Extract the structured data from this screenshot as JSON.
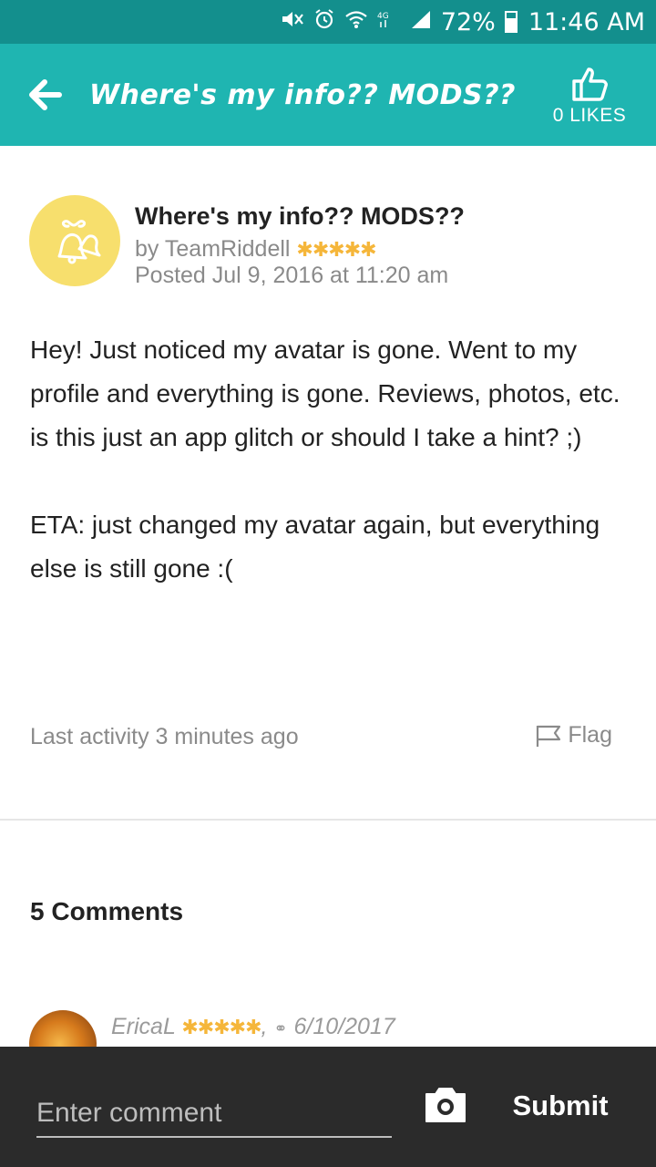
{
  "status_bar": {
    "battery_percent": "72%",
    "time": "11:46 AM",
    "icons": [
      "mute-icon",
      "alarm-icon",
      "wifi-icon",
      "lte-icon",
      "signal-icon",
      "battery-icon"
    ]
  },
  "app_bar": {
    "title": "Where's my info?? MODS??",
    "likes_label": "0 LIKES",
    "icons": [
      "back-arrow-icon",
      "thumbs-up-icon"
    ]
  },
  "post": {
    "title": "Where's my info?? MODS??",
    "author_prefix": "by",
    "author": "TeamRiddell",
    "rating_stars": "✱✱✱✱✱",
    "posted": "Posted Jul 9, 2016 at 11:20 am",
    "avatar_icon": "bells-icon",
    "body": [
      "Hey! Just noticed my avatar is gone. Went to my profile and everything is gone. Reviews, photos, etc. is this just an app glitch or should I take a hint? ;)",
      "ETA: just changed my avatar again, but everything else is still gone :("
    ],
    "last_activity": "Last activity 3 minutes ago",
    "flag_label": "Flag"
  },
  "comments": {
    "heading": "5 Comments",
    "items": [
      {
        "author": "EricaL",
        "rating_stars": "✱✱✱✱✱",
        "separator": ",",
        "date": "6/10/2017"
      }
    ]
  },
  "composer": {
    "placeholder": "Enter comment",
    "submit_label": "Submit"
  },
  "colors": {
    "status_bar": "#138f8d",
    "app_bar": "#1fb5b1",
    "stars": "#f5b63a",
    "avatar_bg": "#f7df6d",
    "bottom_bar": "#2b2b2b"
  }
}
